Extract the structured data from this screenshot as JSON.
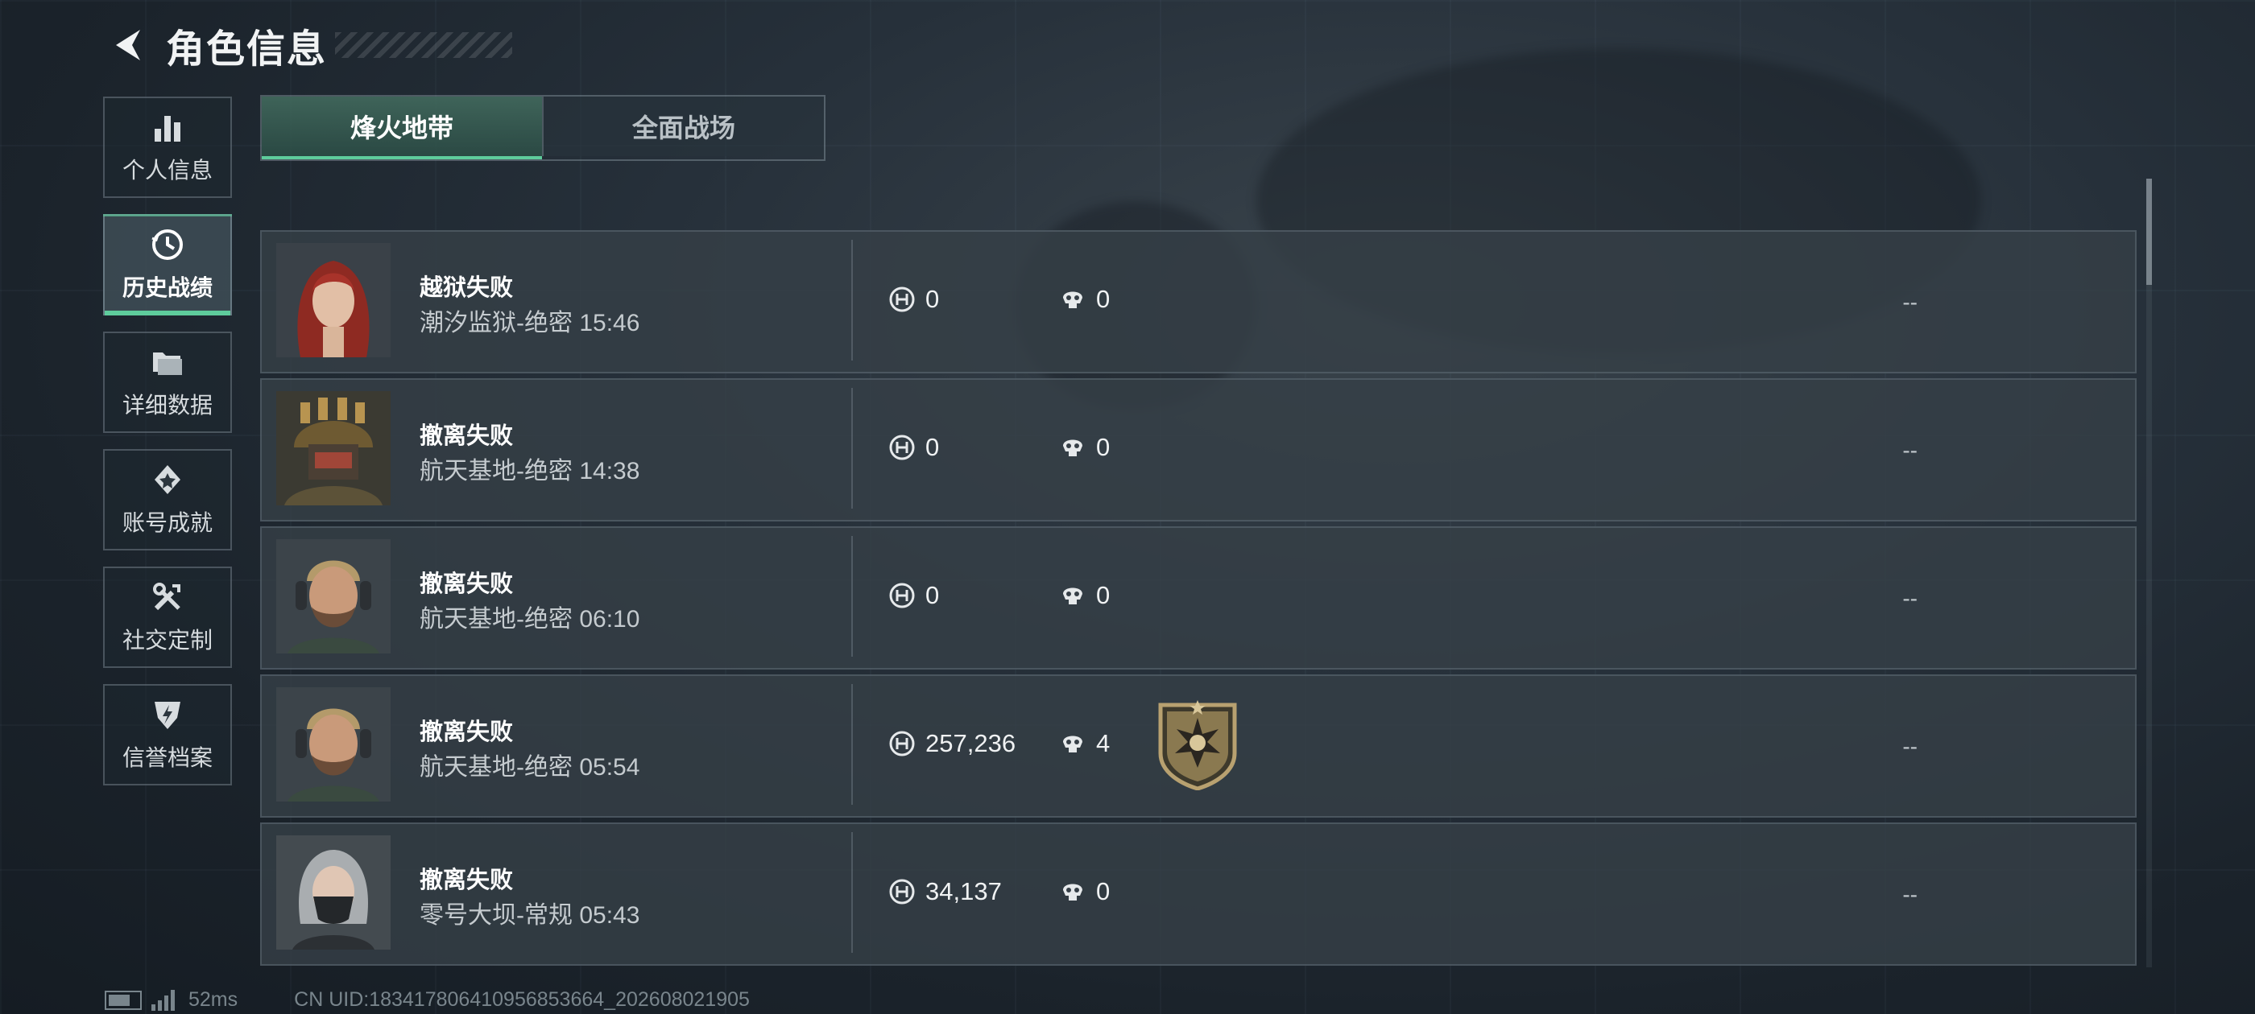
{
  "header": {
    "title": "角色信息",
    "back_icon": "back-arrow-icon"
  },
  "sidebar": {
    "items": [
      {
        "label": "个人信息",
        "icon": "bar-chart-icon",
        "active": false
      },
      {
        "label": "历史战绩",
        "icon": "history-clock-icon",
        "active": true
      },
      {
        "label": "详细数据",
        "icon": "folder-icon",
        "active": false
      },
      {
        "label": "账号成就",
        "icon": "achievement-icon",
        "active": false
      },
      {
        "label": "社交定制",
        "icon": "tools-icon",
        "active": false
      },
      {
        "label": "信誉档案",
        "icon": "reputation-shield-icon",
        "active": false
      }
    ]
  },
  "tabs": [
    {
      "label": "烽火地带",
      "active": true
    },
    {
      "label": "全面战场",
      "active": false
    }
  ],
  "matches": [
    {
      "result": "越狱失败",
      "map_info": "潮汐监狱-绝密 15:46",
      "money": "0",
      "kills": "0",
      "medal": false,
      "extra": "--",
      "avatar": "red-hair"
    },
    {
      "result": "撤离失败",
      "map_info": "航天基地-绝密 14:38",
      "money": "0",
      "kills": "0",
      "medal": false,
      "extra": "--",
      "avatar": "helmet"
    },
    {
      "result": "撤离失败",
      "map_info": "航天基地-绝密 06:10",
      "money": "0",
      "kills": "0",
      "medal": false,
      "extra": "--",
      "avatar": "headset"
    },
    {
      "result": "撤离失败",
      "map_info": "航天基地-绝密 05:54",
      "money": "257,236",
      "kills": "4",
      "medal": true,
      "extra": "--",
      "avatar": "headset"
    },
    {
      "result": "撤离失败",
      "map_info": "零号大坝-常规 05:43",
      "money": "34,137",
      "kills": "0",
      "medal": false,
      "extra": "--",
      "avatar": "mask"
    }
  ],
  "footer": {
    "ping": "52ms",
    "uid": "CN UID:1834178064109568536​64_202608021905"
  },
  "colors": {
    "accent": "#5ecc9c",
    "row_bg": "#363f47",
    "medal_gold": "#b8a170"
  }
}
